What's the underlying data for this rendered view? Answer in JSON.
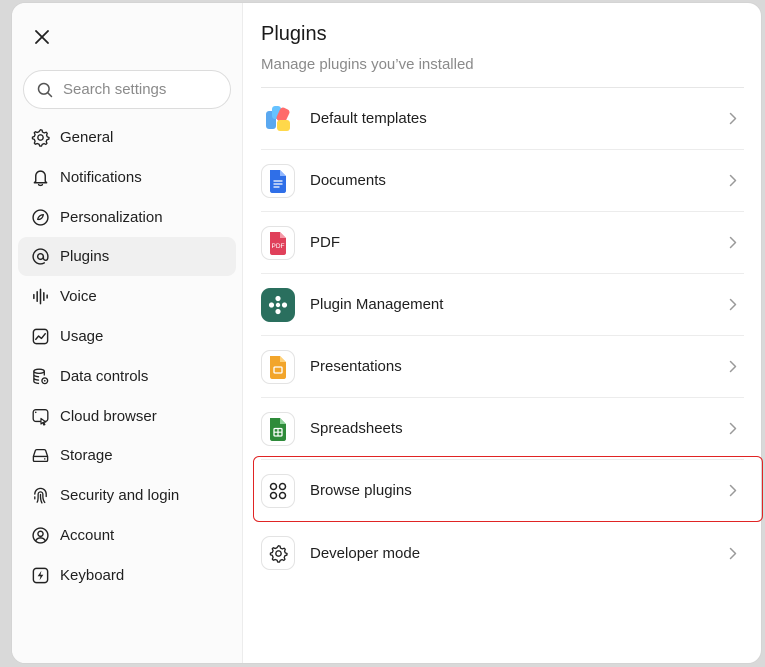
{
  "sidebar": {
    "search_placeholder": "Search settings",
    "items": [
      {
        "label": "General",
        "icon": "gear-icon"
      },
      {
        "label": "Notifications",
        "icon": "bell-icon"
      },
      {
        "label": "Personalization",
        "icon": "personalization-icon"
      },
      {
        "label": "Plugins",
        "icon": "at-sign-icon",
        "active": true
      },
      {
        "label": "Voice",
        "icon": "waveform-icon"
      },
      {
        "label": "Usage",
        "icon": "chart-icon"
      },
      {
        "label": "Data controls",
        "icon": "database-gear-icon"
      },
      {
        "label": "Cloud browser",
        "icon": "cloud-browser-icon"
      },
      {
        "label": "Storage",
        "icon": "hard-drive-icon"
      },
      {
        "label": "Security and login",
        "icon": "fingerprint-icon"
      },
      {
        "label": "Account",
        "icon": "user-circle-icon"
      },
      {
        "label": "Keyboard",
        "icon": "bolt-icon"
      }
    ]
  },
  "main": {
    "title": "Plugins",
    "subtitle": "Manage plugins you’ve installed",
    "plugins": [
      {
        "label": "Default templates",
        "icon": "templates-icon"
      },
      {
        "label": "Documents",
        "icon": "document-icon"
      },
      {
        "label": "PDF",
        "icon": "pdf-icon",
        "icon_text": "PDF"
      },
      {
        "label": "Plugin Management",
        "icon": "plugin-management-icon"
      },
      {
        "label": "Presentations",
        "icon": "presentation-icon"
      },
      {
        "label": "Spreadsheets",
        "icon": "spreadsheet-icon"
      },
      {
        "label": "Browse plugins",
        "icon": "four-circles-icon",
        "highlighted": true
      },
      {
        "label": "Developer mode",
        "icon": "gear-icon"
      }
    ]
  },
  "colors": {
    "highlight": "#e02424",
    "active_nav_bg": "#f0f0f0",
    "plugin_management_bg": "#2a6f5e"
  }
}
